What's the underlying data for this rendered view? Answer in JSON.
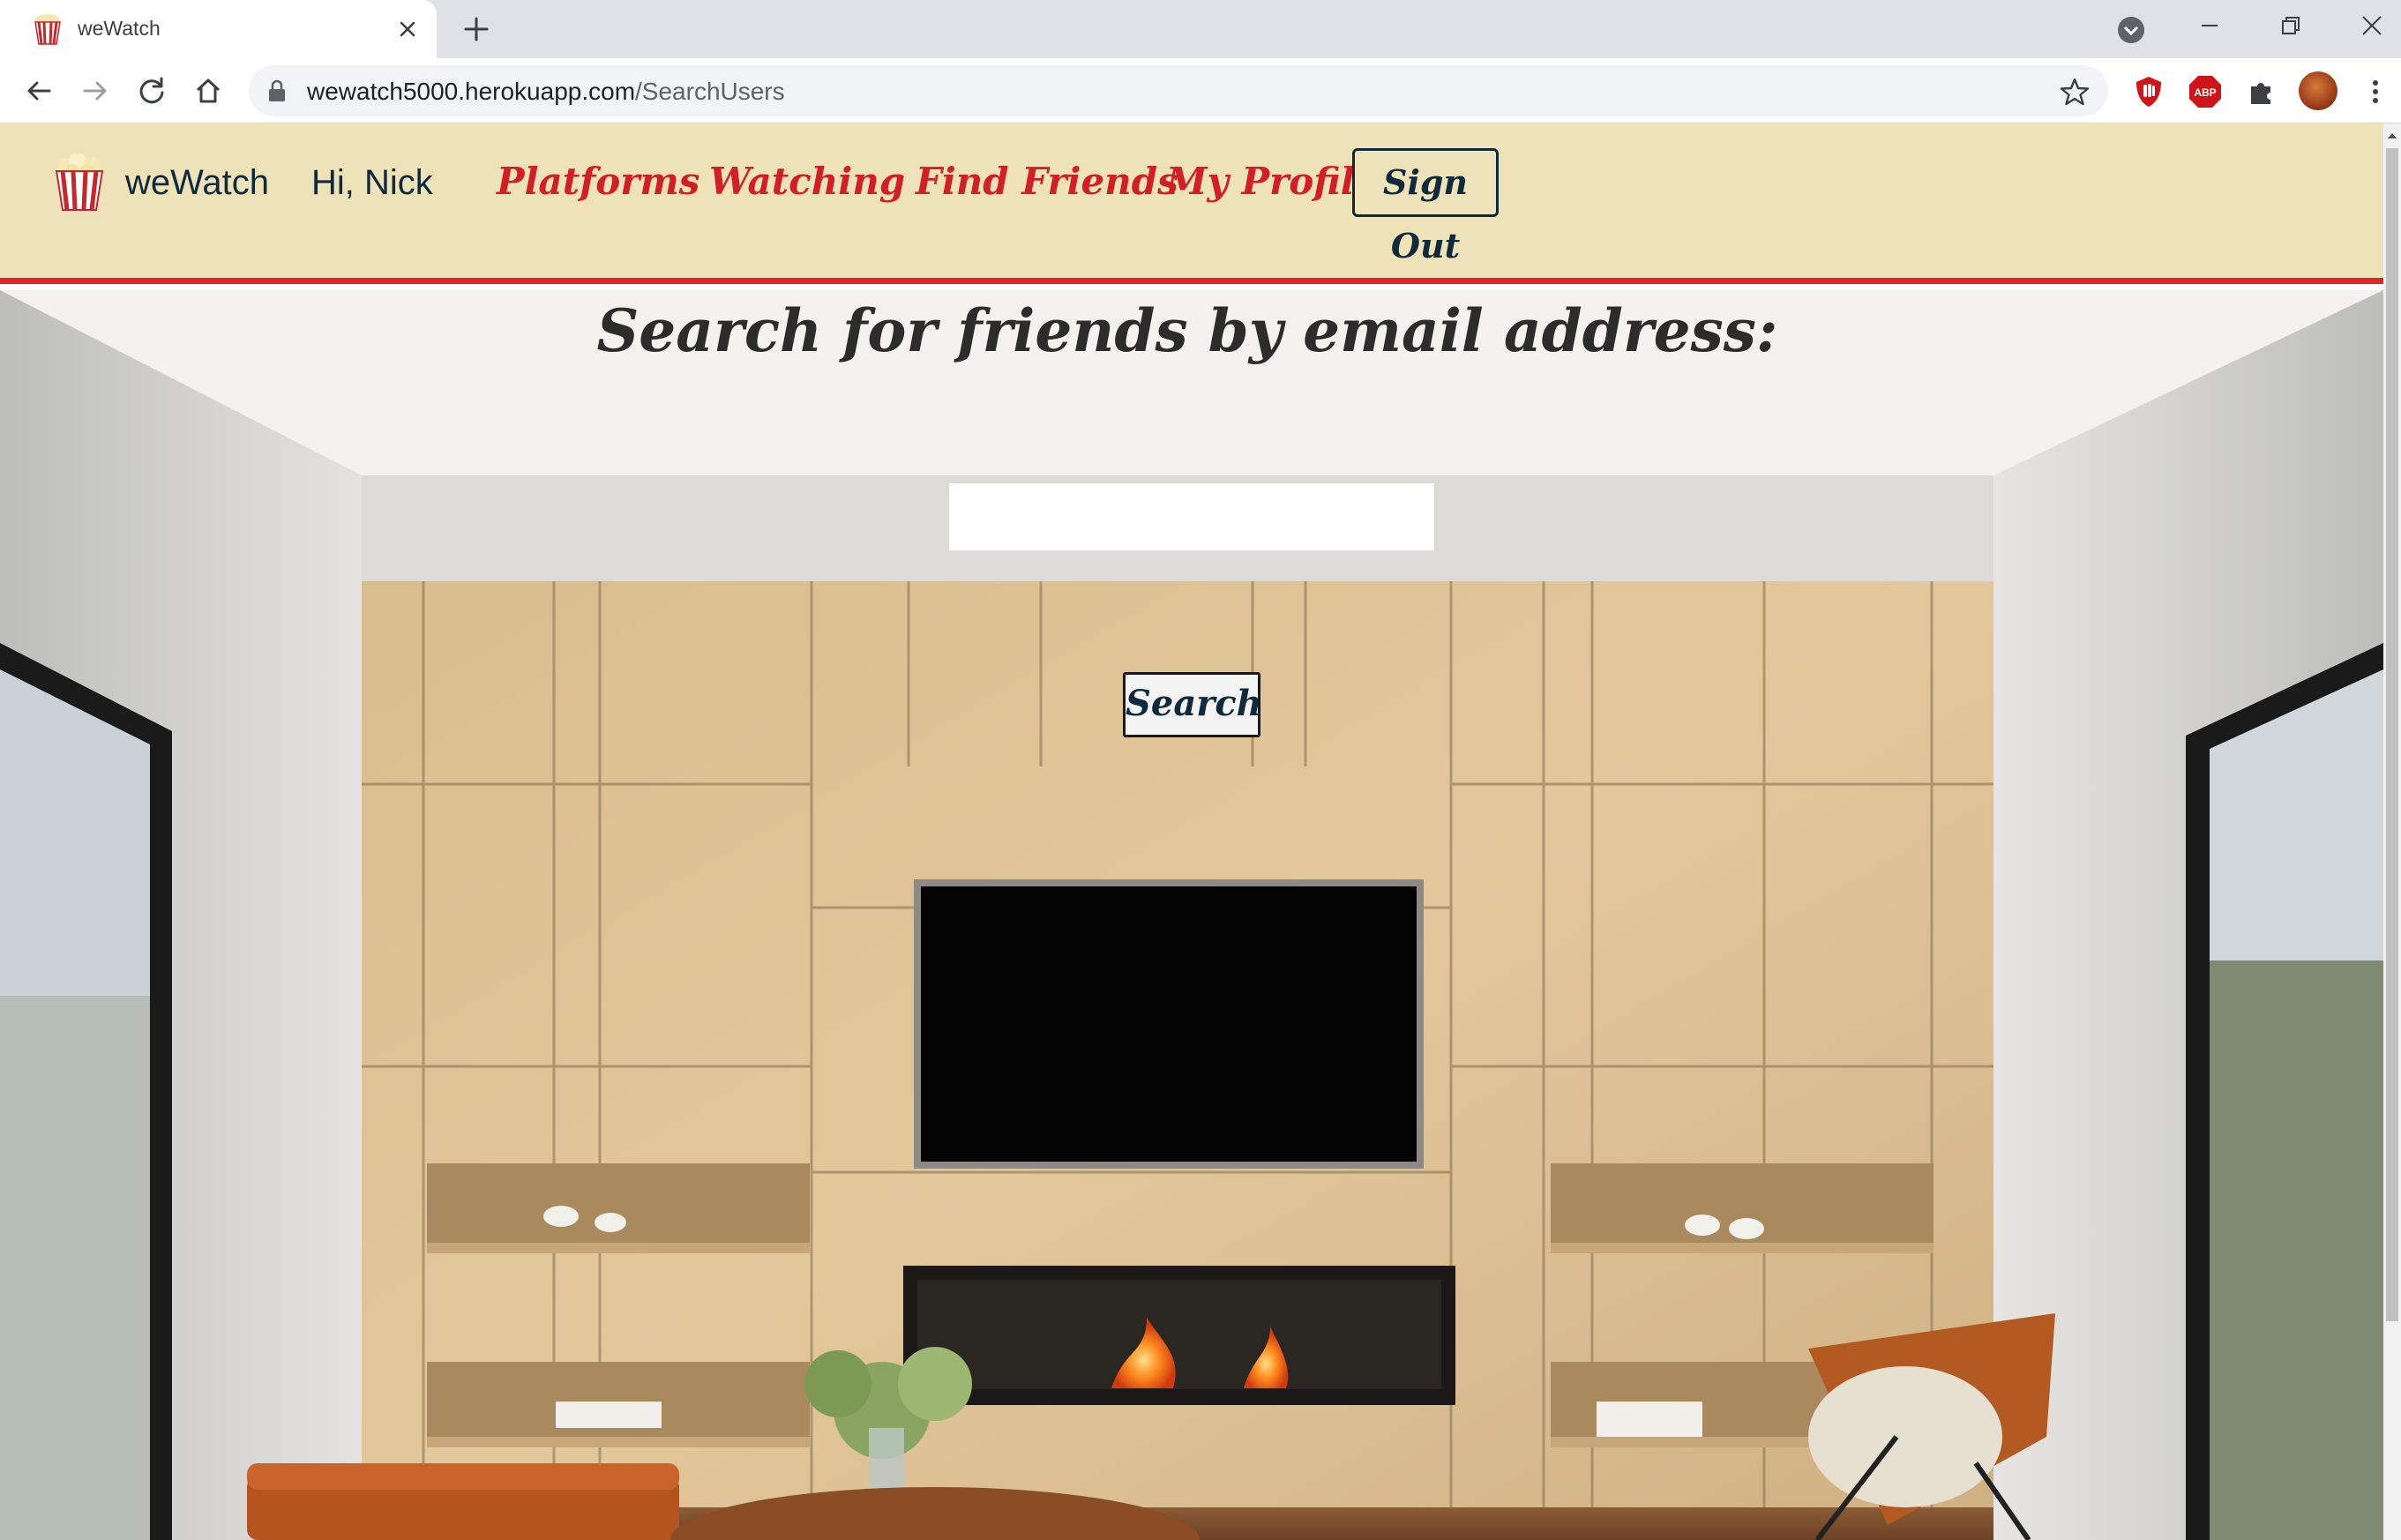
{
  "browser": {
    "tab_title": "weWatch",
    "url_host": "wewatch5000.herokuapp.com",
    "url_path": "/SearchUsers",
    "extensions": [
      "ublock-icon",
      "adblock-plus-icon",
      "puzzle-icon"
    ]
  },
  "navbar": {
    "brand": "weWatch",
    "greeting": "Hi, Nick",
    "links": {
      "platforms": "Platforms",
      "watching": "Watching",
      "find_friends": "Find Friends",
      "my_profile": "My Profile"
    },
    "sign_out": "Sign Out"
  },
  "main": {
    "heading": "Search for friends by email address:",
    "search_value": "",
    "search_button": "Search"
  },
  "colors": {
    "navbar_bg": "#ede2b8",
    "accent_red": "#e0262a",
    "link_red": "#d21f25",
    "navy": "#0f2a3d"
  }
}
